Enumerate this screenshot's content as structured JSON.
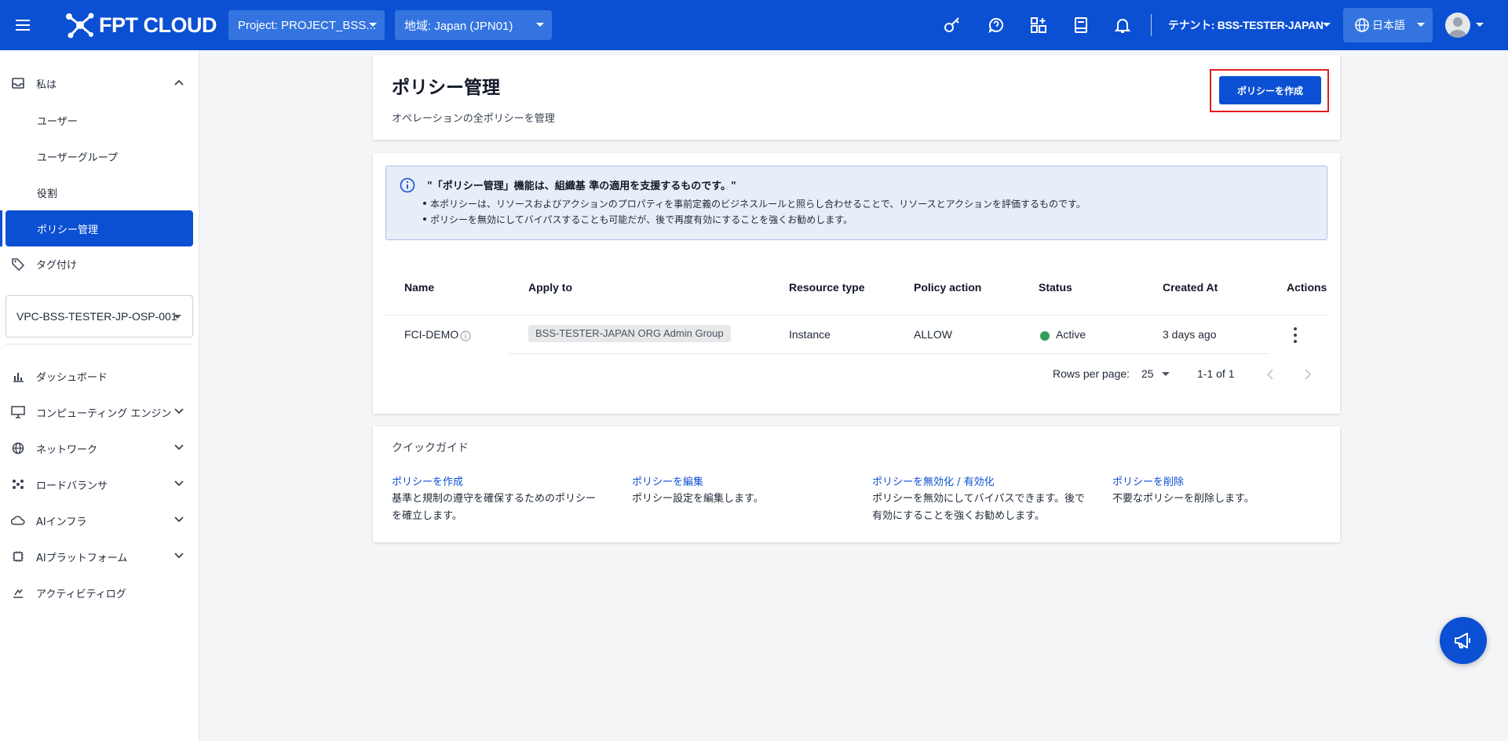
{
  "topbar": {
    "brand": "FPT CLOUD",
    "project_select": "Project: PROJECT_BSS...",
    "region_select": "地域: Japan (JPN01)",
    "tenant": "テナント: BSS-TESTER-JAPAN",
    "language": "日本語",
    "icons": [
      "key-icon",
      "support-icon",
      "apps-icon",
      "docs-icon",
      "bell-icon"
    ]
  },
  "sidebar": {
    "section_label": "私は",
    "sub_items": [
      "ユーザー",
      "ユーザーグループ",
      "役割"
    ],
    "active_item": "ポリシー管理",
    "tagging": "タグ付け",
    "vpc_select": "VPC-BSS-TESTER-JP-OSP-001",
    "nav": [
      {
        "label": "ダッシュボード",
        "icon": "chart-icon",
        "expandable": false
      },
      {
        "label": "コンピューティング エンジン",
        "icon": "monitor-icon",
        "expandable": true
      },
      {
        "label": "ネットワーク",
        "icon": "globe-icon",
        "expandable": true
      },
      {
        "label": "ロードバランサ",
        "icon": "load-balancer-icon",
        "expandable": true
      },
      {
        "label": "AIインフラ",
        "icon": "cloud-icon",
        "expandable": true
      },
      {
        "label": "AIプラットフォーム",
        "icon": "chip-icon",
        "expandable": true
      },
      {
        "label": "アクティビティログ",
        "icon": "activity-icon",
        "expandable": false
      }
    ]
  },
  "header": {
    "title": "ポリシー管理",
    "subtitle": "オペレーションの全ポリシーを管理",
    "create_button": "ポリシーを作成"
  },
  "info": {
    "title": "\"「ポリシー管理」機能は、組織基 準の適用を支援するものです。\"",
    "bullets": [
      "本ポリシーは、リソースおよびアクションのプロパティを事前定義のビジネスルールと照らし合わせることで、リソースとアクションを評価するものです。",
      "ポリシーを無効にしてバイパスすることも可能だが、後で再度有効にすることを強くお勧めします。"
    ]
  },
  "table": {
    "columns": [
      "Name",
      "Apply to",
      "Resource type",
      "Policy action",
      "Status",
      "Created At",
      "Actions"
    ],
    "rows": [
      {
        "name": "FCI-DEMO",
        "apply_to": "BSS-TESTER-JAPAN ORG Admin Group",
        "resource_type": "Instance",
        "policy_action": "ALLOW",
        "status": "Active",
        "created_at": "3 days ago"
      }
    ],
    "rows_per_page_label": "Rows per page:",
    "rows_per_page": "25",
    "range": "1-1 of 1"
  },
  "quick_guide": {
    "title": "クイックガイド",
    "items": [
      {
        "link": "ポリシーを作成",
        "desc": "基準と規制の遵守を確保するためのポリシーを確立します。"
      },
      {
        "link": "ポリシーを編集",
        "desc": "ポリシー設定を編集します。"
      },
      {
        "link": "ポリシーを無効化 / 有効化",
        "desc": "ポリシーを無効にしてバイパスできます。後で有効にすることを強くお勧めします。"
      },
      {
        "link": "ポリシーを削除",
        "desc": "不要なポリシーを削除します。"
      }
    ]
  },
  "colors": {
    "brand_blue": "#0b50d3",
    "active_green": "#2e9e57",
    "highlight_red": "#e11d1d",
    "info_bg": "#e8eef8"
  }
}
